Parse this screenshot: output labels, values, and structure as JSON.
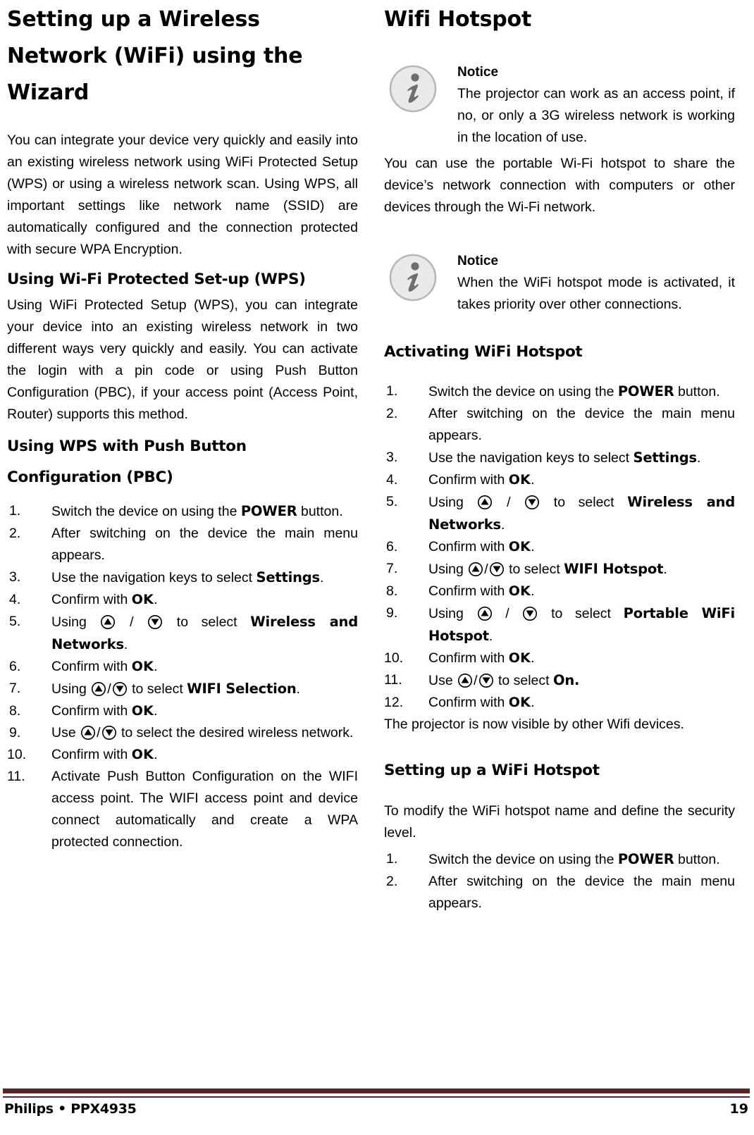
{
  "document": {
    "footer": {
      "brand": "Philips • PPX4935",
      "page_number": "19",
      "rule_color": "#5c2425"
    }
  },
  "left_column": {
    "title_lines": [
      "Setting up a Wireless",
      "Network (WiFi) using the",
      "Wizard"
    ],
    "intro_paragraph": "You can integrate your device very quickly and easily into an existing wireless network using WiFi Protected Setup (WPS) or using a wireless network scan. Using WPS, all important settings like network name (SSID) are automatically configured and the connection protected with secure WPA Encryption.",
    "section_wps": {
      "heading": "Using Wi-Fi Protected Set-up (WPS)",
      "paragraph": "Using WiFi Protected Setup (WPS), you can integrate your device into an existing wireless network in two different ways very quickly and easily. You can activate the login with a pin code or using Push Button Configuration (PBC), if your access point (Access Point, Router) supports this method."
    },
    "section_pbc": {
      "heading_line1": "Using WPS with Push Button",
      "heading_line2": "Configuration (PBC)",
      "steps": [
        {
          "num": "1.",
          "parts": [
            {
              "t": "text",
              "v": "Switch the device on using the "
            },
            {
              "t": "bold",
              "v": "POWER"
            },
            {
              "t": "text",
              "v": " button."
            }
          ]
        },
        {
          "num": "2.",
          "parts": [
            {
              "t": "text",
              "v": "After switching on the device the main menu appears."
            }
          ]
        },
        {
          "num": "3.",
          "parts": [
            {
              "t": "text",
              "v": "Use the navigation keys to select "
            },
            {
              "t": "bold",
              "v": "Settings"
            },
            {
              "t": "text",
              "v": "."
            }
          ]
        },
        {
          "num": "4.",
          "parts": [
            {
              "t": "text",
              "v": "Confirm with "
            },
            {
              "t": "bold",
              "v": "OK"
            },
            {
              "t": "text",
              "v": "."
            }
          ]
        },
        {
          "num": "5.",
          "parts": [
            {
              "t": "text",
              "v": "Using "
            },
            {
              "t": "icon",
              "v": "nav-up-key-icon"
            },
            {
              "t": "text",
              "v": " / "
            },
            {
              "t": "icon",
              "v": "nav-down-key-icon"
            },
            {
              "t": "text",
              "v": " to select "
            },
            {
              "t": "bold",
              "v": "Wireless and Networks"
            },
            {
              "t": "text",
              "v": "."
            }
          ]
        },
        {
          "num": "6.",
          "parts": [
            {
              "t": "text",
              "v": "Confirm with "
            },
            {
              "t": "bold",
              "v": "OK"
            },
            {
              "t": "text",
              "v": "."
            }
          ]
        },
        {
          "num": "7.",
          "parts": [
            {
              "t": "text",
              "v": "Using "
            },
            {
              "t": "icon",
              "v": "nav-up-key-icon"
            },
            {
              "t": "text",
              "v": "/"
            },
            {
              "t": "icon",
              "v": "nav-down-key-icon"
            },
            {
              "t": "text",
              "v": " to select "
            },
            {
              "t": "bold",
              "v": "WIFI Selection"
            },
            {
              "t": "text",
              "v": "."
            }
          ]
        },
        {
          "num": "8.",
          "parts": [
            {
              "t": "text",
              "v": "Confirm with "
            },
            {
              "t": "bold",
              "v": "OK"
            },
            {
              "t": "text",
              "v": "."
            }
          ]
        },
        {
          "num": "9.",
          "parts": [
            {
              "t": "text",
              "v": "Use "
            },
            {
              "t": "icon",
              "v": "nav-up-key-icon"
            },
            {
              "t": "text",
              "v": "/"
            },
            {
              "t": "icon",
              "v": "nav-down-key-icon"
            },
            {
              "t": "text",
              "v": " to select the desired wireless network."
            }
          ]
        },
        {
          "num": "10.",
          "parts": [
            {
              "t": "text",
              "v": "Confirm with "
            },
            {
              "t": "bold",
              "v": "OK"
            },
            {
              "t": "text",
              "v": "."
            }
          ]
        },
        {
          "num": "11.",
          "parts": [
            {
              "t": "text",
              "v": "Activate Push Button Configuration on the WIFI access point. The WIFI access point and device connect automatically and create a WPA protected connection."
            }
          ]
        }
      ]
    }
  },
  "right_column": {
    "title": "Wifi Hotspot",
    "notice_1": {
      "label": "Notice",
      "text": "The projector can work as an access point, if no, or only a 3G wireless network is working in the location of use.",
      "icon": "info-icon"
    },
    "paragraph_1": "You can use the portable Wi-Fi hotspot to share the device’s network connection with computers or other devices through the Wi-Fi network.",
    "notice_2": {
      "label": "Notice",
      "text": "When the WiFi hotspot mode is activated, it takes priority over other connections.",
      "icon": "info-icon"
    },
    "section_activating": {
      "heading": "Activating WiFi Hotspot",
      "steps": [
        {
          "num": "1.",
          "parts": [
            {
              "t": "text",
              "v": "Switch the device on using the "
            },
            {
              "t": "bold",
              "v": "POWER"
            },
            {
              "t": "text",
              "v": " button."
            }
          ]
        },
        {
          "num": "2.",
          "parts": [
            {
              "t": "text",
              "v": "After switching on the device the main menu appears."
            }
          ]
        },
        {
          "num": "3.",
          "parts": [
            {
              "t": "text",
              "v": "Use the navigation keys to select "
            },
            {
              "t": "bold",
              "v": "Settings"
            },
            {
              "t": "text",
              "v": "."
            }
          ]
        },
        {
          "num": "4.",
          "parts": [
            {
              "t": "text",
              "v": "Confirm with "
            },
            {
              "t": "bold",
              "v": "OK"
            },
            {
              "t": "text",
              "v": "."
            }
          ]
        },
        {
          "num": "5.",
          "parts": [
            {
              "t": "text",
              "v": "Using "
            },
            {
              "t": "icon",
              "v": "nav-up-key-icon"
            },
            {
              "t": "text",
              "v": " / "
            },
            {
              "t": "icon",
              "v": "nav-down-key-icon"
            },
            {
              "t": "text",
              "v": " to select "
            },
            {
              "t": "bold",
              "v": "Wireless and Networks"
            },
            {
              "t": "text",
              "v": "."
            }
          ]
        },
        {
          "num": "6.",
          "parts": [
            {
              "t": "text",
              "v": "Confirm with "
            },
            {
              "t": "bold",
              "v": "OK"
            },
            {
              "t": "text",
              "v": "."
            }
          ]
        },
        {
          "num": "7.",
          "parts": [
            {
              "t": "text",
              "v": "Using "
            },
            {
              "t": "icon",
              "v": "nav-up-key-icon"
            },
            {
              "t": "text",
              "v": "/"
            },
            {
              "t": "icon",
              "v": "nav-down-key-icon"
            },
            {
              "t": "text",
              "v": " to select "
            },
            {
              "t": "bold",
              "v": "WIFI Hotspot"
            },
            {
              "t": "text",
              "v": "."
            }
          ]
        },
        {
          "num": "8.",
          "parts": [
            {
              "t": "text",
              "v": "Confirm with "
            },
            {
              "t": "bold",
              "v": "OK"
            },
            {
              "t": "text",
              "v": "."
            }
          ]
        },
        {
          "num": "9.",
          "parts": [
            {
              "t": "text",
              "v": "Using "
            },
            {
              "t": "icon",
              "v": "nav-up-key-icon"
            },
            {
              "t": "text",
              "v": " / "
            },
            {
              "t": "icon",
              "v": "nav-down-key-icon"
            },
            {
              "t": "text",
              "v": " to select "
            },
            {
              "t": "bold",
              "v": "Portable WiFi Hotspot"
            },
            {
              "t": "text",
              "v": "."
            }
          ]
        },
        {
          "num": "10.",
          "parts": [
            {
              "t": "text",
              "v": "Confirm with "
            },
            {
              "t": "bold",
              "v": "OK"
            },
            {
              "t": "text",
              "v": "."
            }
          ]
        },
        {
          "num": "11.",
          "parts": [
            {
              "t": "text",
              "v": "Use "
            },
            {
              "t": "icon",
              "v": "nav-up-key-icon"
            },
            {
              "t": "text",
              "v": "/"
            },
            {
              "t": "icon",
              "v": "nav-down-key-icon"
            },
            {
              "t": "text",
              "v": " to select "
            },
            {
              "t": "bold",
              "v": "On."
            }
          ]
        },
        {
          "num": "12.",
          "parts": [
            {
              "t": "text",
              "v": "Confirm with "
            },
            {
              "t": "bold",
              "v": "OK"
            },
            {
              "t": "text",
              "v": "."
            }
          ]
        }
      ],
      "closing_line": "The projector is now visible by other Wifi devices."
    },
    "section_setting_up": {
      "heading": "Setting up a WiFi Hotspot",
      "intro": "To modify the WiFi hotspot name and define the security level.",
      "steps": [
        {
          "num": "1.",
          "parts": [
            {
              "t": "text",
              "v": "Switch the device on using the "
            },
            {
              "t": "bold",
              "v": "POWER"
            },
            {
              "t": "text",
              "v": " button."
            }
          ]
        },
        {
          "num": "2.",
          "parts": [
            {
              "t": "text",
              "v": "After switching on the device the main menu appears."
            }
          ]
        }
      ]
    }
  }
}
